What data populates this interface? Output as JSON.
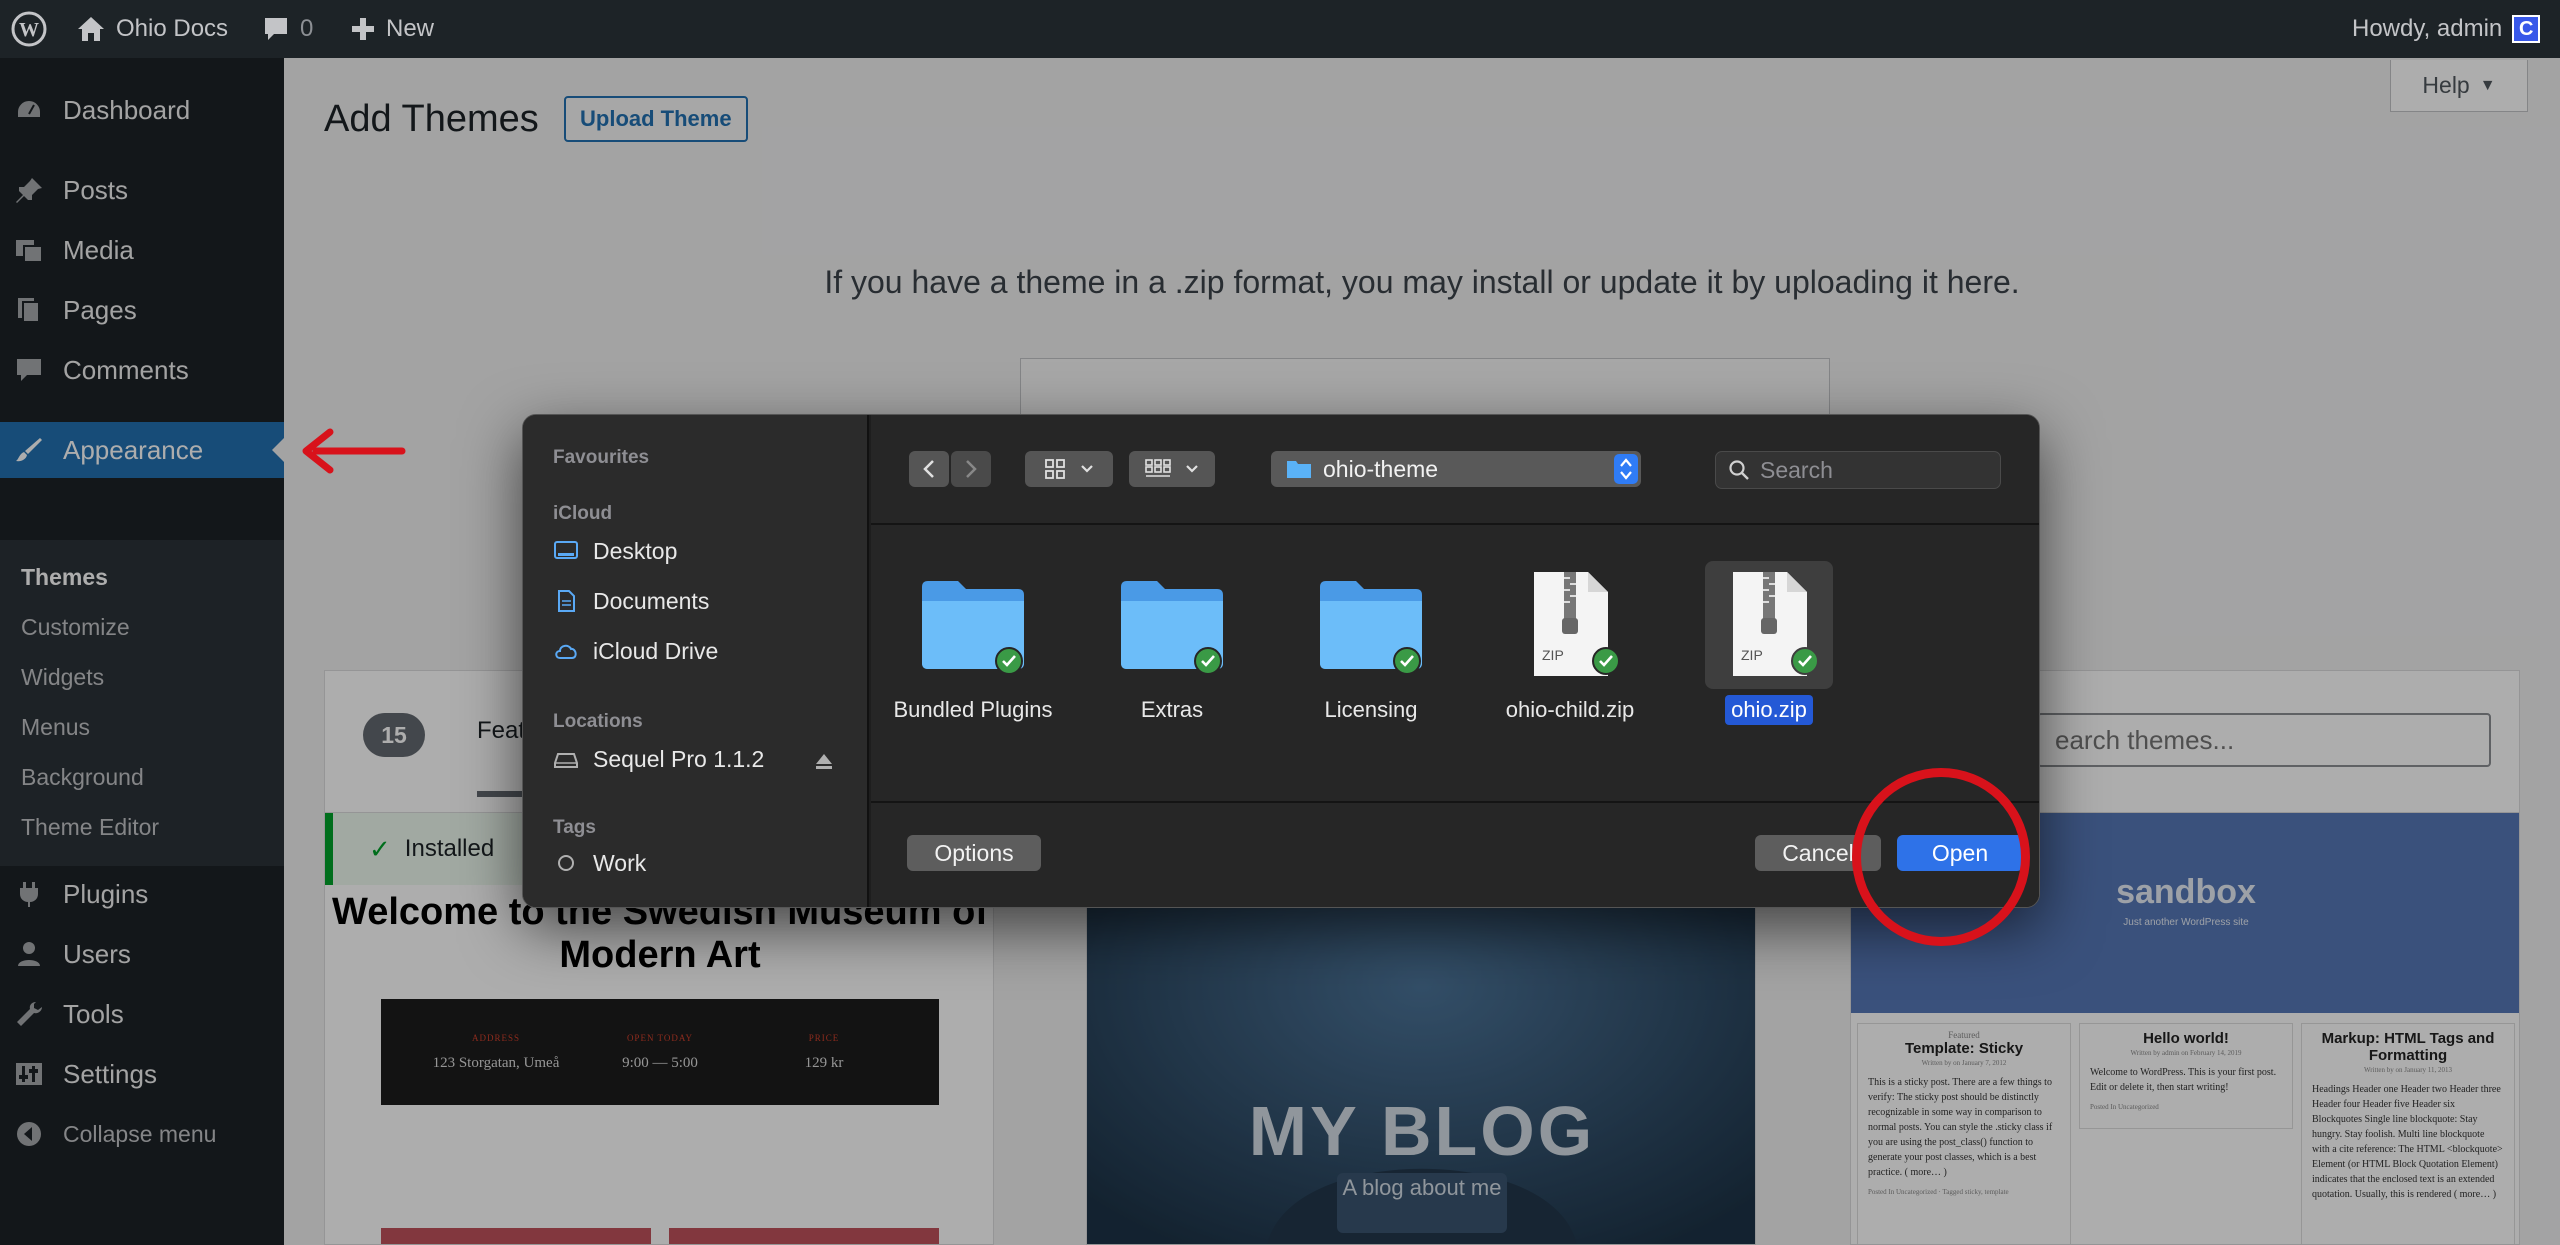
{
  "adminbar": {
    "site_name": "Ohio Docs",
    "comments_count": "0",
    "new_label": "New",
    "howdy": "Howdy, admin",
    "avatar_letter": "C"
  },
  "sidebar": {
    "dashboard": "Dashboard",
    "posts": "Posts",
    "media": "Media",
    "pages": "Pages",
    "comments": "Comments",
    "appearance": "Appearance",
    "submenu": [
      "Themes",
      "Customize",
      "Widgets",
      "Menus",
      "Background",
      "Theme Editor"
    ],
    "plugins": "Plugins",
    "users": "Users",
    "tools": "Tools",
    "settings": "Settings",
    "collapse": "Collapse menu"
  },
  "main": {
    "title": "Add Themes",
    "upload_button": "Upload Theme",
    "help": "Help",
    "upload_message": "If you have a theme in a .zip format, you may install or update it by uploading it here.",
    "theme_count": "15",
    "filter_tab": "Feat",
    "search_placeholder": "earch themes...",
    "installed_label": "Installed"
  },
  "themes": {
    "swedish": {
      "title": "Welcome to the Swedish Museum of Modern Art",
      "info": [
        {
          "label": "ADDRESS",
          "value": "123 Storgatan, Umeå"
        },
        {
          "label": "OPEN TODAY",
          "value": "9:00 — 5:00"
        },
        {
          "label": "PRICE",
          "value": "129 kr"
        }
      ]
    },
    "blog": {
      "title": "MY BLOG",
      "subtitle": "A blog about me"
    },
    "sandbox": {
      "title": "sandbox",
      "subtitle": "Just another WordPress site",
      "columns": [
        {
          "kicker": "Featured",
          "title": "Template: Sticky",
          "byline": "Written by on January 7, 2012",
          "body": "This is a sticky post. There are a few things to verify: The sticky post should be distinctly recognizable in some way in comparison to normal posts. You can style the .sticky class if you are using the post_class() function to generate your post classes, which is a best practice. ( more… )",
          "meta": "Posted In Uncategorized · Tagged sticky, template"
        },
        {
          "kicker": "",
          "title": "Hello world!",
          "byline": "Written by admin on February 14, 2019",
          "body": "Welcome to WordPress. This is your first post. Edit or delete it, then start writing!",
          "meta": "Posted In Uncategorized"
        },
        {
          "kicker": "",
          "title": "Markup: HTML Tags and Formatting",
          "byline": "Written by on January 11, 2013",
          "body": "Headings Header one Header two Header three Header four Header five Header six Blockquotes Single line blockquote: Stay hungry. Stay foolish. Multi line blockquote with a cite reference: The HTML <blockquote> Element (or HTML Block Quotation Element) indicates that the enclosed text is an extended quotation. Usually, this is rendered ( more… )",
          "meta": ""
        }
      ]
    }
  },
  "dialog": {
    "sections": {
      "favourites": "Favourites",
      "icloud": "iCloud",
      "locations": "Locations",
      "tags": "Tags"
    },
    "sidebar_items": {
      "desktop": "Desktop",
      "documents": "Documents",
      "icloud_drive": "iCloud Drive",
      "sequel_pro": "Sequel Pro 1.1.2",
      "work": "Work"
    },
    "current_folder": "ohio-theme",
    "search_placeholder": "Search",
    "files": [
      {
        "name": "Bundled Plugins",
        "kind": "folder"
      },
      {
        "name": "Extras",
        "kind": "folder"
      },
      {
        "name": "Licensing",
        "kind": "folder"
      },
      {
        "name": "ohio-child.zip",
        "kind": "zip"
      },
      {
        "name": "ohio.zip",
        "kind": "zip"
      }
    ],
    "zip_label": "ZIP",
    "options": "Options",
    "cancel": "Cancel",
    "open": "Open"
  },
  "colors": {
    "wp_dark": "#1d2327",
    "wp_blue": "#2271b1",
    "mac_accent": "#2e72e8",
    "annotation_red": "#d8121b"
  }
}
